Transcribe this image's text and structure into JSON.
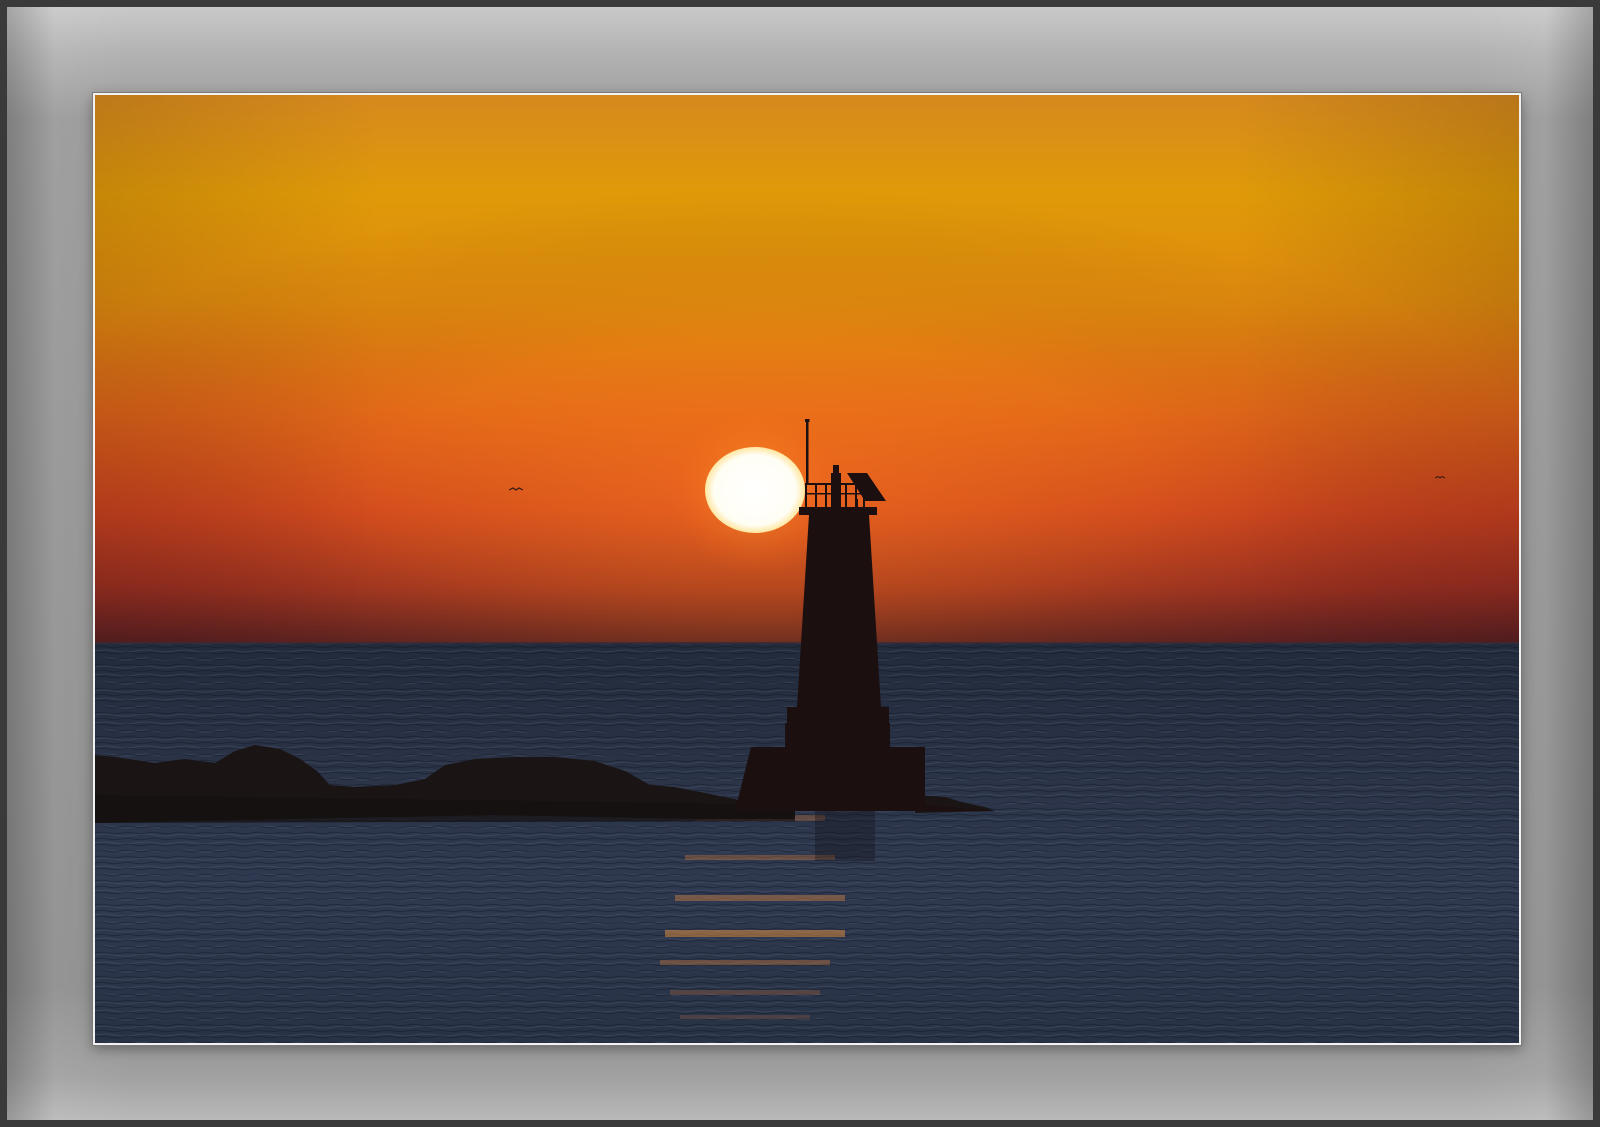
{
  "scene": {
    "subject": "lighthouse-at-sunrise",
    "colors": {
      "sky_top": "#d98a1f",
      "sky_gold": "#e2a106",
      "sky_orange": "#e0681a",
      "sky_red": "#c83a1e",
      "horizon": "#5a1f20",
      "sun": "#ffffff",
      "sea": "#1f2a3d",
      "silhouette": "#1a0d0d",
      "frame": "#9a9a9a",
      "mat_border": "#f2f2f2"
    }
  }
}
